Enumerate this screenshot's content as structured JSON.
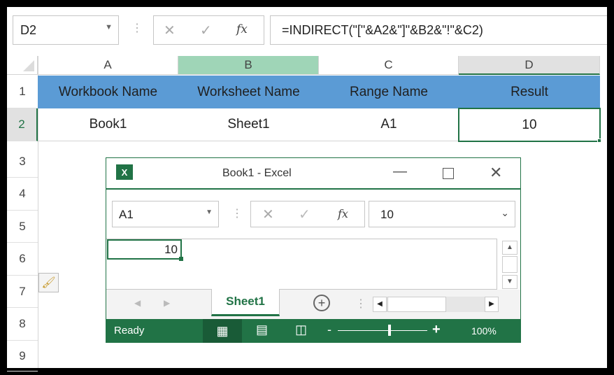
{
  "main": {
    "name_box": "D2",
    "formula": "=INDIRECT(\"[\"&A2&\"]\"&B2&\"!\"&C2)",
    "columns": [
      "A",
      "B",
      "C",
      "D"
    ],
    "rows": [
      "1",
      "2",
      "3",
      "4",
      "5",
      "6",
      "7",
      "8",
      "9"
    ],
    "headers": [
      "Workbook Name",
      "Worksheet Name",
      "Range Name",
      "Result"
    ],
    "values": [
      "Book1",
      "Sheet1",
      "A1",
      "10"
    ]
  },
  "popup": {
    "title": "Book1 - Excel",
    "name_box": "A1",
    "formula": "10",
    "cell_value": "10",
    "sheet_tab": "Sheet1",
    "status": "Ready",
    "zoom": "100%"
  },
  "colors": {
    "accent": "#217346",
    "header_fill": "#5b9bd5",
    "selected_col": "#9fd5b7"
  }
}
